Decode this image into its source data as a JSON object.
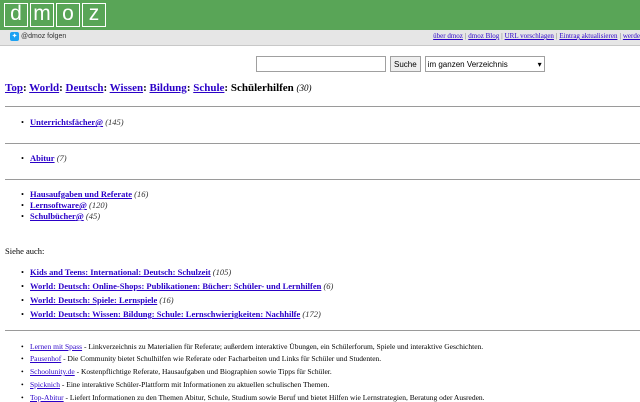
{
  "header": {
    "logo_letters": [
      "d",
      "m",
      "o",
      "z"
    ],
    "twitter_label": "@dmoz folgen",
    "top_links": [
      "über dmoz",
      "dmoz Blog",
      "URL vorschlagen",
      "Eintrag aktualisieren",
      "werde E"
    ]
  },
  "search": {
    "input_value": "",
    "button_label": "Suche",
    "scope_selected": "im ganzen Verzeichnis"
  },
  "breadcrumb": {
    "items": [
      "Top",
      "World",
      "Deutsch",
      "Wissen",
      "Bildung",
      "Schule"
    ],
    "current": "Schülerhilfen",
    "count": "(30)"
  },
  "categories_group1": [
    {
      "name": "Unterrichtsfächer",
      "at": "@",
      "count": "(145)"
    }
  ],
  "categories_group2": [
    {
      "name": "Abitur",
      "at": "",
      "count": "(7)"
    }
  ],
  "categories_group3": [
    {
      "name": "Hausaufgaben und Referate",
      "at": "",
      "count": "(16)"
    },
    {
      "name": "Lernsoftware",
      "at": "@",
      "count": "(120)"
    },
    {
      "name": "Schulbücher",
      "at": "@",
      "count": "(45)"
    }
  ],
  "see_also": {
    "label": "Siehe auch:",
    "items": [
      {
        "name": "Kids and Teens: International: Deutsch: Schulzeit",
        "count": "(105)"
      },
      {
        "name": "World: Deutsch: Online-Shops: Publikationen: Bücher: Schüler- und Lernhilfen",
        "count": "(6)"
      },
      {
        "name": "World: Deutsch: Spiele: Lernspiele",
        "count": "(16)"
      },
      {
        "name": "World: Deutsch: Wissen: Bildung: Schule: Lernschwierigkeiten: Nachhilfe",
        "count": "(172)"
      }
    ]
  },
  "sites": [
    {
      "name": "Lernen mit Spass",
      "desc": " - Linkverzeichnis zu Materialien für Referate; außerdem interaktive Übungen, ein Schülerforum, Spiele und interaktive Geschichten."
    },
    {
      "name": "Pausenhof",
      "desc": " - Die Community bietet Schulhilfen wie Referate oder Facharbeiten und Links für Schüler und Studenten."
    },
    {
      "name": "Schoolunity.de",
      "desc": " - Kostenpflichtige Referate, Hausaufgaben und Biographien sowie Tipps für Schüler."
    },
    {
      "name": "Spicknich",
      "desc": " - Eine interaktive Schüler-Plattform mit Informationen zu aktuellen schulischen Themen."
    },
    {
      "name": "Top-Abitur",
      "desc": " - Liefert Informationen zu den Themen Abitur, Schule, Studium sowie Beruf und bietet Hilfen wie Lernstrategien, Beratung oder Ausreden."
    }
  ]
}
